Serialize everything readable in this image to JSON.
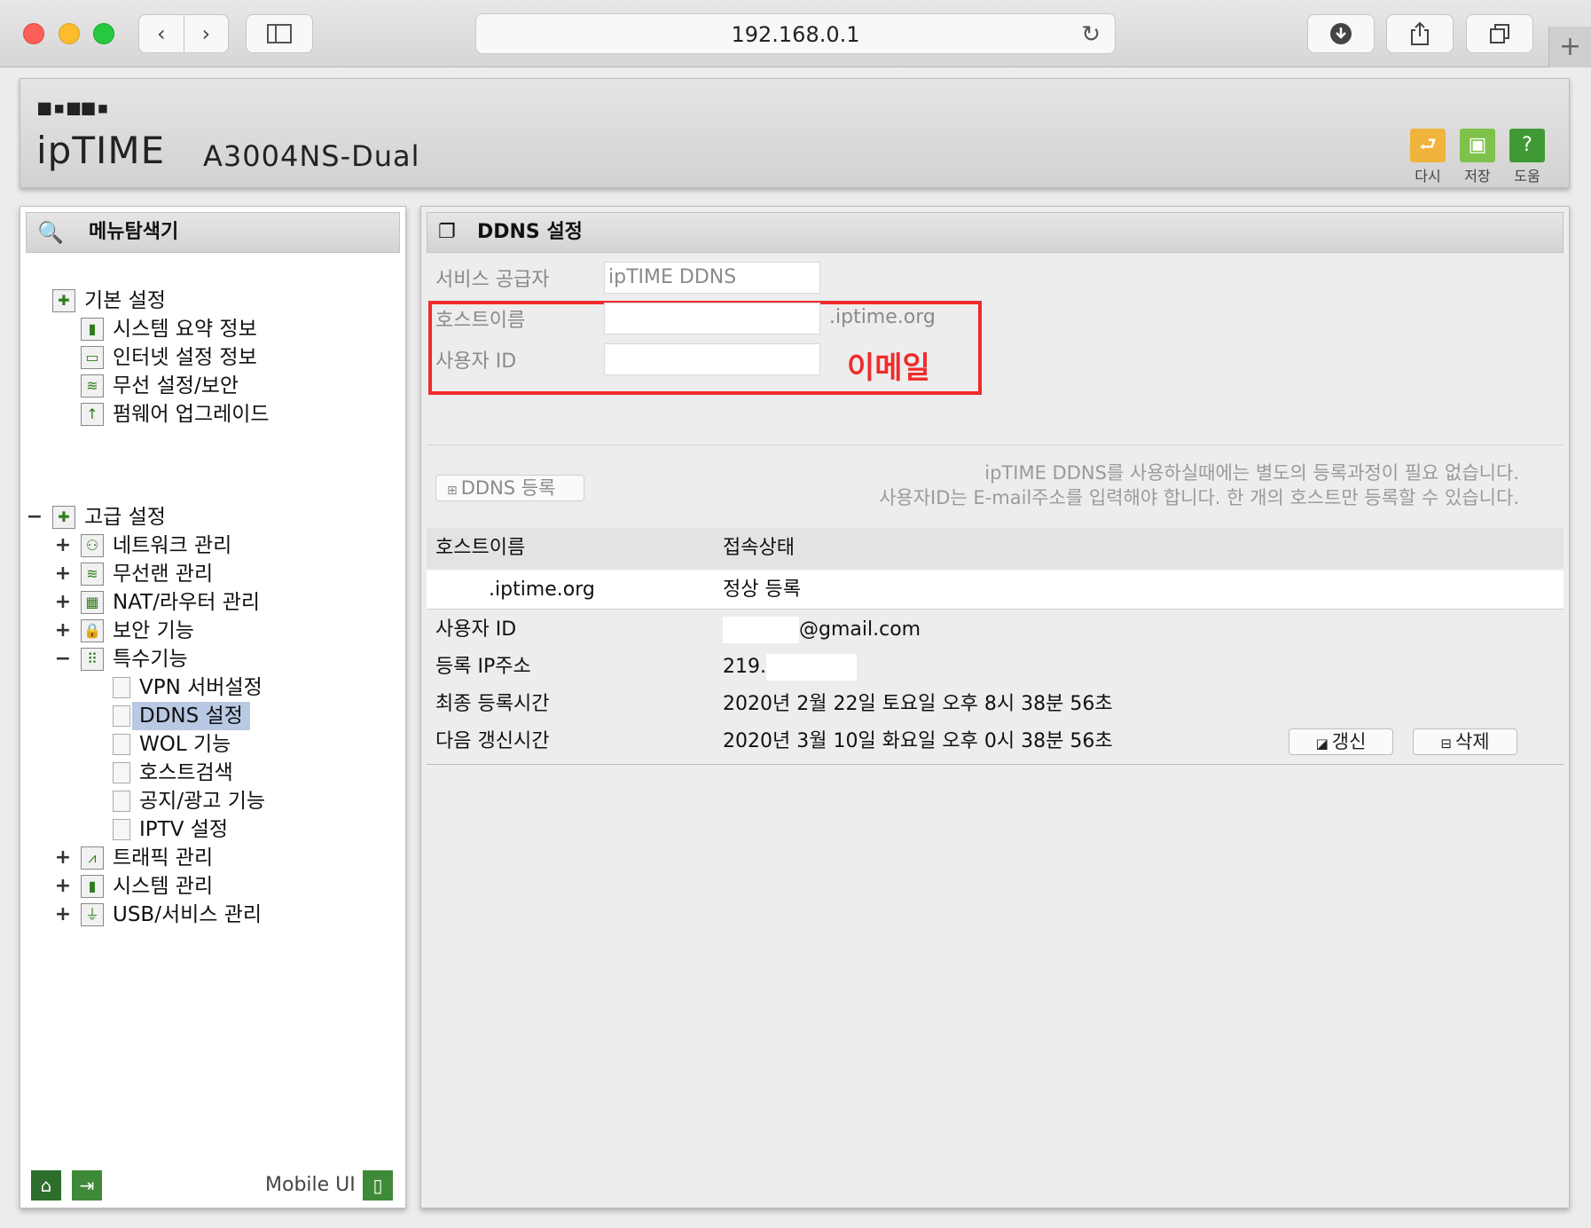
{
  "browser": {
    "back": "‹",
    "forward": "›",
    "url": "192.168.0.1",
    "new_tab": "+"
  },
  "header": {
    "brand_dots": "■▪■■▪",
    "brand": "ipTIME",
    "model": "A3004NS-Dual",
    "actions": [
      {
        "label": "다시",
        "color": "#f0b33c",
        "icon": "undo-icon"
      },
      {
        "label": "저장",
        "color": "#7ec24a",
        "icon": "save-icon"
      },
      {
        "label": "도움",
        "color": "#3f9a36",
        "icon": "help-icon"
      }
    ]
  },
  "menu": {
    "title": "메뉴탐색기",
    "basic": {
      "label": "기본 설정",
      "items": [
        "시스템 요약 정보",
        "인터넷 설정 정보",
        "무선 설정/보안",
        "펌웨어 업그레이드"
      ]
    },
    "advanced": {
      "label": "고급 설정",
      "items": [
        "네트워크 관리",
        "무선랜 관리",
        "NAT/라우터 관리",
        "보안 기능",
        "특수기능"
      ],
      "special": [
        "VPN 서버설정",
        "DDNS 설정",
        "WOL 기능",
        "호스트검색",
        "공지/광고 기능",
        "IPTV 설정"
      ],
      "more": [
        "트래픽 관리",
        "시스템 관리",
        "USB/서비스 관리"
      ]
    },
    "collapse": "−",
    "expand": "+",
    "mobile": "Mobile UI"
  },
  "ddns": {
    "title": "DDNS 설정",
    "provider_label": "서비스 공급자",
    "provider_value": "ipTIME DDNS",
    "hostname_label": "호스트이름",
    "hostname_suffix": ".iptime.org",
    "userid_label": "사용자 ID",
    "email_note": "이메일",
    "register_button": "DDNS 등록",
    "info_line1": "ipTIME DDNS를 사용하실때에는 별도의 등록과정이 필요 없습니다.",
    "info_line2": "사용자ID는 E-mail주소를 입력해야 합니다. 한 개의 호스트만 등록할 수 있습니다.",
    "table": {
      "col_host": "호스트이름",
      "col_status": "접속상태",
      "host_value": ".iptime.org",
      "status_value": "정상 등록"
    },
    "details": {
      "userid_label": "사용자 ID",
      "userid_value": "@gmail.com",
      "ip_label": "등록 IP주소",
      "ip_value": "219.",
      "last_label": "최종 등록시간",
      "last_value": "2020년 2월 22일 토요일 오후 8시 38분 56초",
      "next_label": "다음 갱신시간",
      "next_value": "2020년 3월 10일 화요일 오후 0시 38분 56초"
    },
    "refresh_button": "갱신",
    "delete_button": "삭제"
  }
}
